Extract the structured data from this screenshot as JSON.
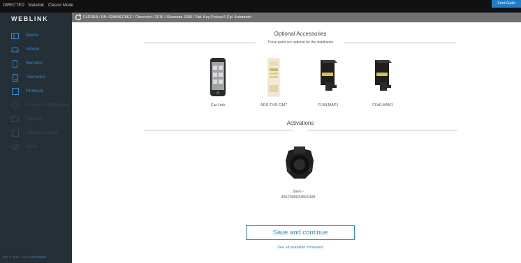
{
  "topbar": {
    "links": [
      "DIRECTED",
      "Matelink",
      "Classic Mode"
    ],
    "user": "Fred Gallo"
  },
  "sidebar": {
    "logo": "WEBLINK",
    "items": [
      {
        "label": "Device",
        "icon": "device-icon",
        "state": "normal"
      },
      {
        "label": "Vehicle",
        "icon": "car-icon",
        "state": "normal"
      },
      {
        "label": "Remotes",
        "icon": "remote-icon",
        "state": "normal"
      },
      {
        "label": "Telematics",
        "icon": "telematics-icon",
        "state": "normal"
      },
      {
        "label": "Firmware",
        "icon": "firmware-icon",
        "state": "active"
      },
      {
        "label": "Firmware Configuration",
        "icon": "config-icon",
        "state": "disabled"
      },
      {
        "label": "Flashing",
        "icon": "flash-icon",
        "state": "disabled"
      },
      {
        "label": "Installation Guide",
        "icon": "guide-icon",
        "state": "disabled"
      },
      {
        "label": "Finish",
        "icon": "finish-icon",
        "state": "disabled"
      }
    ],
    "footer_text": "DEI © 2019 - v2.6.0",
    "footer_link": "DirectWeb"
  },
  "breadcrumb": "FLRSBA / SN: 928A8EC8EF / Chevrolet / 2016 / Silverado 1500 / Std. Key Pickup 6 Cyl. Automatic",
  "optional": {
    "title": "Optional Accessories",
    "subtitle": "These parts are optional for the installation",
    "products": [
      {
        "name": "Car Link"
      },
      {
        "name": "ADS-THR-GM7"
      },
      {
        "name": "FLWLMAP1"
      },
      {
        "name": "FLWLMAN1"
      }
    ]
  },
  "activations": {
    "title": "Activations",
    "item_name": "Siren -",
    "item_id": "4567000034561309"
  },
  "actions": {
    "save_label": "Save and continue",
    "see_all_label": "See all available firmwares"
  },
  "colors": {
    "accent": "#2b8ad6",
    "sidebar_bg": "#253036",
    "topbar_bg": "#111111",
    "breadcrumb_bg": "#6f7275",
    "user_button": "#1e7fc8"
  }
}
